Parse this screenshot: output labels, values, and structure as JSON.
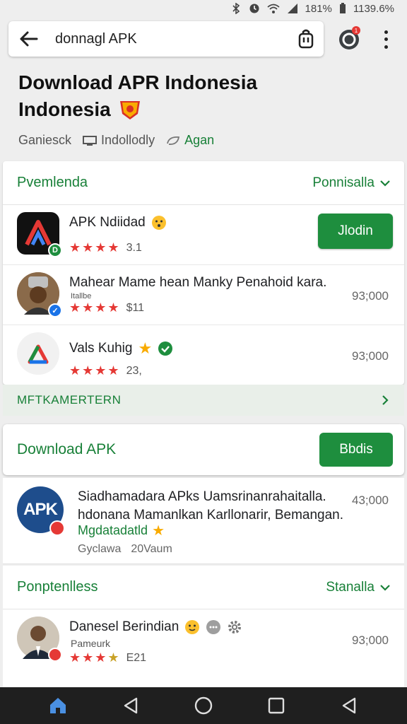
{
  "status_bar": {
    "battery": "181%",
    "time": "1139.6%"
  },
  "search": {
    "query": "donnagl APK"
  },
  "header": {
    "title_line1": "Download APR Indonesia",
    "title_line2": "Indonesia",
    "meta": [
      "Ganiesck",
      "Indollodly",
      "Agan"
    ]
  },
  "card1": {
    "title": "Pvemlenda",
    "link": "Ponnisalla",
    "apps": [
      {
        "name": "APK Ndiidad",
        "rating": "3.1",
        "button": "Jlodin"
      },
      {
        "name": "Mahear Mame hean Manky Penahoid kara.",
        "sub": "Itallbe",
        "rating": "$11",
        "value": "93;000"
      },
      {
        "name": "Vals Kuhig",
        "rating": "23,",
        "value": "93;000"
      }
    ],
    "footer": "MFTKAMERTERN"
  },
  "download_card": {
    "title": "Download APK",
    "button": "Bbdis"
  },
  "featured": {
    "icon_text": "APK",
    "desc_line1": "Siadhamadara APks Uamsrinanrahaitalla.",
    "desc_line2": "hdonana Mamanlkan Karllonarir, Bemangan.",
    "tag": "Mgdatadatld",
    "meta1": "Gyclawa",
    "meta2": "20Vaum",
    "value": "43;000"
  },
  "card3": {
    "title": "Ponptenlless",
    "link": "Stanalla",
    "apps": [
      {
        "name": "Danesel Berindian",
        "sub": "Pameurk",
        "rating": "E21",
        "value": "93;000"
      }
    ]
  },
  "colors": {
    "accent": "#188038",
    "button": "#1e8e3e",
    "star": "#e53935"
  }
}
